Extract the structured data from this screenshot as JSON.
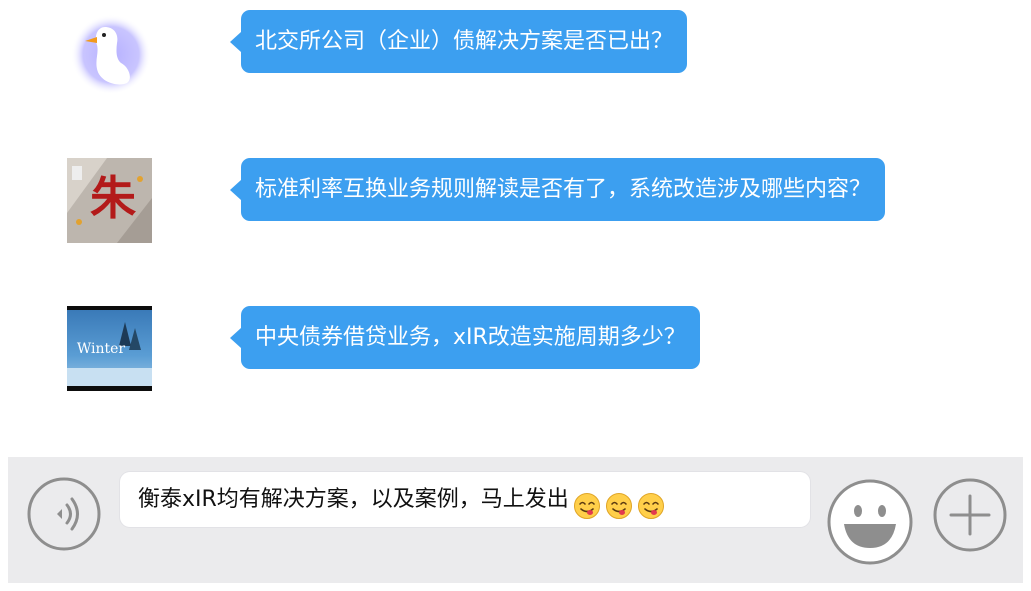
{
  "messages": [
    {
      "avatar": "goose-avatar",
      "text": "北交所公司（企业）债解决方案是否已出？"
    },
    {
      "avatar": "zhu-character-avatar",
      "text": "标准利率互换业务规则解读是否有了，系统改造涉及哪些内容？",
      "avatar_text": "朱"
    },
    {
      "avatar": "winter-scene-avatar",
      "text": "中央债券借贷业务，xIR改造实施周期多少？",
      "avatar_text": "Winter"
    }
  ],
  "composer": {
    "input_text": "衡泰xIR均有解决方案，以及案例，马上发出",
    "emojis": [
      "savoring-face-emoji",
      "savoring-face-emoji",
      "savoring-face-emoji"
    ],
    "voice_icon": "voice-icon",
    "emoji_icon": "smiley-icon",
    "plus_icon": "plus-icon"
  },
  "colors": {
    "bubble": "#3c9ff0",
    "input_bar": "#ebebed"
  }
}
